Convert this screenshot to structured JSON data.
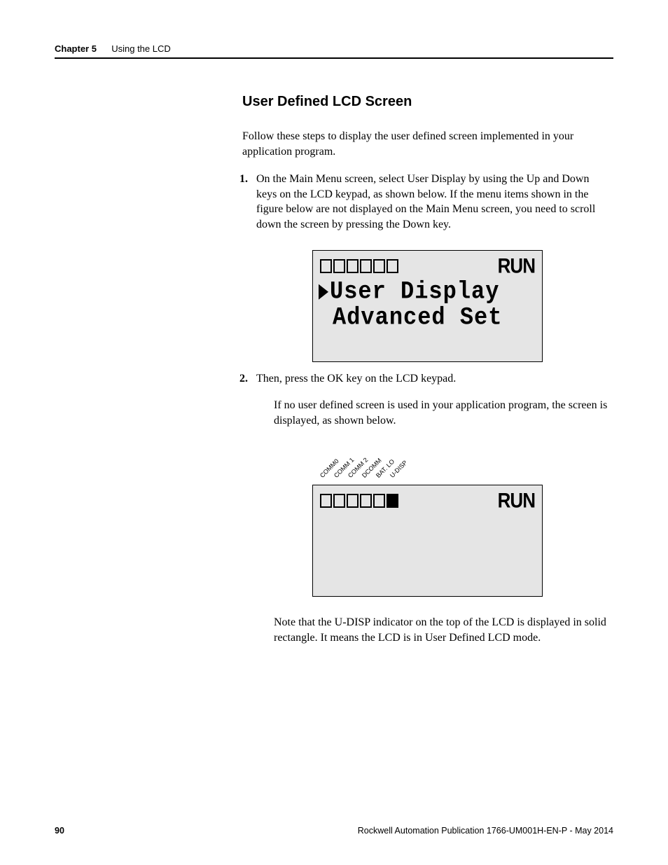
{
  "header": {
    "chapter": "Chapter 5",
    "chapter_title": "Using the LCD"
  },
  "section_title": "User Defined LCD Screen",
  "intro": "Follow these steps to display the user defined screen implemented in your application program.",
  "steps": {
    "s1": {
      "num": "1.",
      "text": "On the Main Menu screen, select User Display by using the Up and Down keys on the LCD keypad, as shown below. If the menu items shown in the figure below are not displayed on the Main Menu screen, you need to scroll down the screen by pressing the Down key."
    },
    "s2": {
      "num": "2.",
      "text": "Then, press the OK key on the LCD keypad.",
      "para": "If no user defined screen is used in your application program, the screen is displayed, as shown below."
    }
  },
  "lcd1": {
    "run": "RUN",
    "line1": "User Display",
    "line2": "Advanced Set"
  },
  "lcd2": {
    "run": "RUN",
    "labels": [
      "COMM0",
      "COMM 1",
      "COMM 2",
      "DCOMM",
      "BAT. LO",
      "U-DISP"
    ]
  },
  "note": "Note that the U-DISP indicator on the top of the LCD is displayed in solid rectangle. It means the LCD is in User Defined LCD mode.",
  "footer": {
    "page": "90",
    "pub": "Rockwell Automation Publication 1766-UM001H-EN-P - May 2014"
  }
}
